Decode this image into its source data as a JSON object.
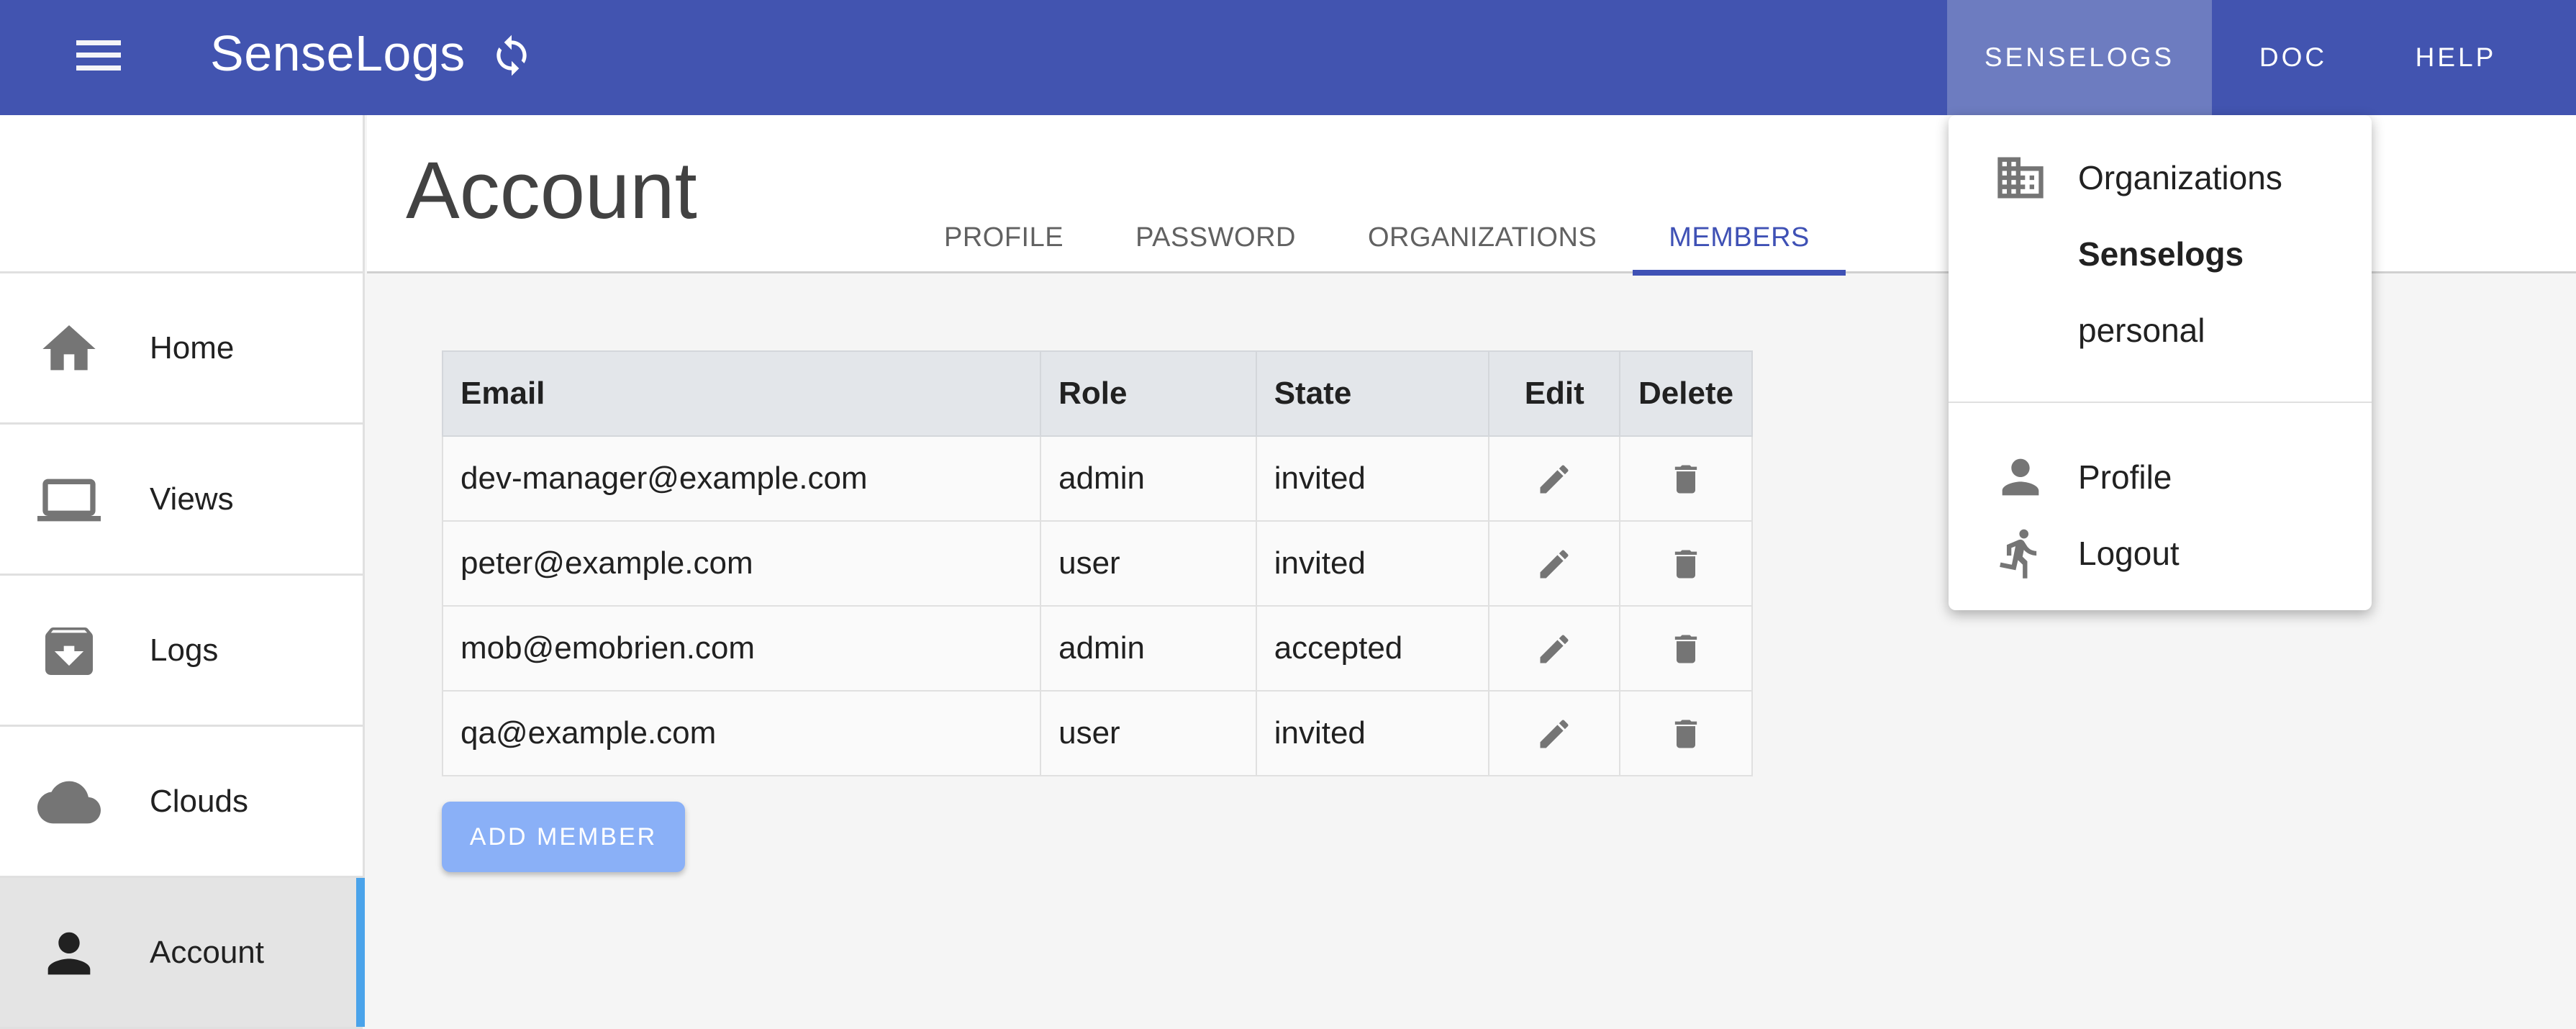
{
  "app": {
    "title": "SenseLogs"
  },
  "topnav": {
    "senselogs": "SENSELOGS",
    "doc": "DOC",
    "help": "HELP"
  },
  "sidebar": {
    "items": [
      {
        "label": "Home",
        "icon": "home-icon"
      },
      {
        "label": "Views",
        "icon": "laptop-icon"
      },
      {
        "label": "Logs",
        "icon": "archive-icon"
      },
      {
        "label": "Clouds",
        "icon": "cloud-icon"
      },
      {
        "label": "Account",
        "icon": "person-icon",
        "active": true
      }
    ]
  },
  "page": {
    "title": "Account",
    "tabs": [
      {
        "label": "PROFILE"
      },
      {
        "label": "PASSWORD"
      },
      {
        "label": "ORGANIZATIONS"
      },
      {
        "label": "MEMBERS",
        "active": true
      }
    ]
  },
  "members": {
    "headers": {
      "email": "Email",
      "role": "Role",
      "state": "State",
      "edit": "Edit",
      "delete": "Delete"
    },
    "rows": [
      {
        "email": "dev-manager@example.com",
        "role": "admin",
        "state": "invited"
      },
      {
        "email": "peter@example.com",
        "role": "user",
        "state": "invited"
      },
      {
        "email": "mob@emobrien.com",
        "role": "admin",
        "state": "accepted"
      },
      {
        "email": "qa@example.com",
        "role": "user",
        "state": "invited"
      }
    ],
    "add_label": "ADD MEMBER"
  },
  "dropdown": {
    "organizations_label": "Organizations",
    "orgs": [
      {
        "label": "Senselogs",
        "selected": true
      },
      {
        "label": "personal",
        "selected": false
      }
    ],
    "profile_label": "Profile",
    "logout_label": "Logout"
  },
  "colors": {
    "primary": "#4254b0",
    "active_tab": "#3f51b5",
    "add_button": "#8ab0f7",
    "sidebar_accent": "#4aa3ea"
  }
}
